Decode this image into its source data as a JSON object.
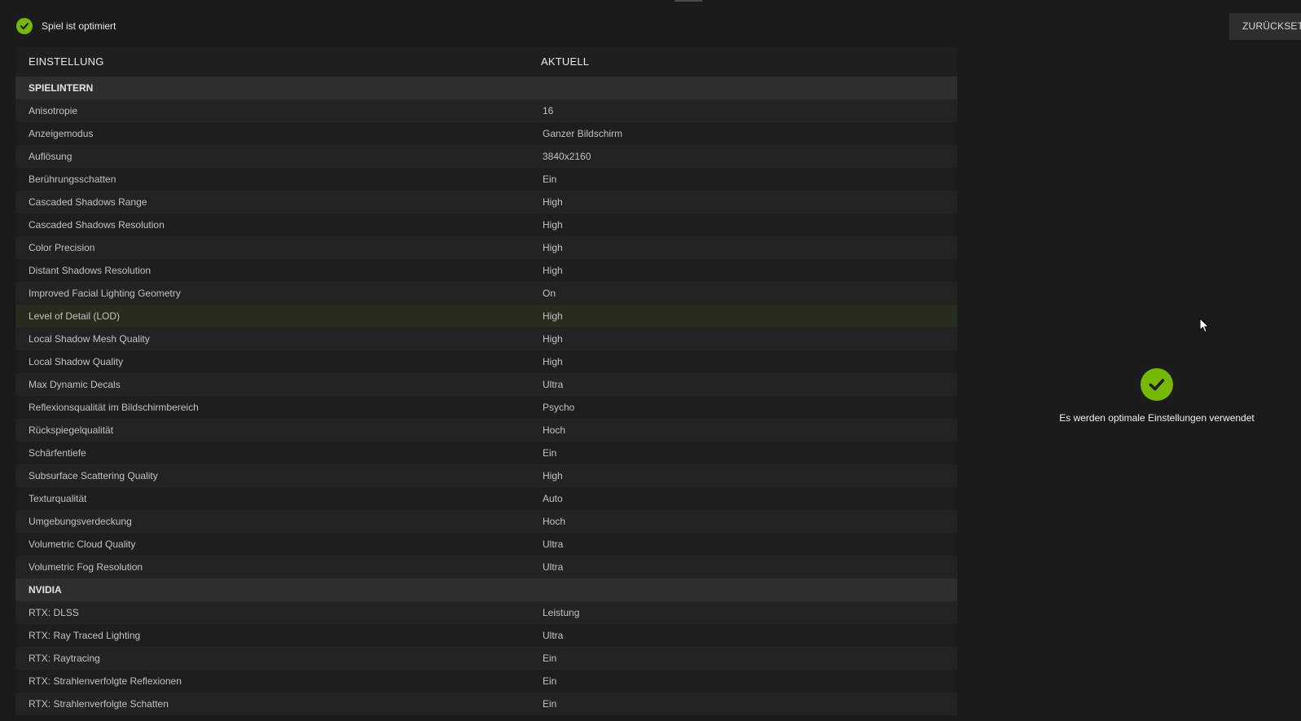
{
  "status": {
    "text": "Spiel ist optimiert",
    "icon": "check-circle-icon"
  },
  "reset_button": {
    "label": "ZURÜCKSETZ"
  },
  "table": {
    "headers": {
      "setting": "EINSTELLUNG",
      "current": "AKTUELL"
    },
    "sections": [
      {
        "title": "SPIELINTERN",
        "rows": [
          {
            "name": "Anisotropie",
            "value": "16"
          },
          {
            "name": "Anzeigemodus",
            "value": "Ganzer Bildschirm"
          },
          {
            "name": "Auflösung",
            "value": "3840x2160"
          },
          {
            "name": "Berührungsschatten",
            "value": "Ein"
          },
          {
            "name": "Cascaded Shadows Range",
            "value": "High"
          },
          {
            "name": "Cascaded Shadows Resolution",
            "value": "High"
          },
          {
            "name": "Color Precision",
            "value": "High"
          },
          {
            "name": "Distant Shadows Resolution",
            "value": "High"
          },
          {
            "name": "Improved Facial Lighting Geometry",
            "value": "On"
          },
          {
            "name": "Level of Detail (LOD)",
            "value": "High",
            "highlighted": true
          },
          {
            "name": "Local Shadow Mesh Quality",
            "value": "High"
          },
          {
            "name": "Local Shadow Quality",
            "value": "High"
          },
          {
            "name": "Max Dynamic Decals",
            "value": "Ultra"
          },
          {
            "name": "Reflexionsqualität im Bildschirmbereich",
            "value": "Psycho"
          },
          {
            "name": "Rückspiegelqualität",
            "value": "Hoch"
          },
          {
            "name": "Schärfentiefe",
            "value": "Ein"
          },
          {
            "name": "Subsurface Scattering Quality",
            "value": "High"
          },
          {
            "name": "Texturqualität",
            "value": "Auto"
          },
          {
            "name": "Umgebungsverdeckung",
            "value": "Hoch"
          },
          {
            "name": "Volumetric Cloud Quality",
            "value": "Ultra"
          },
          {
            "name": "Volumetric Fog Resolution",
            "value": "Ultra"
          }
        ]
      },
      {
        "title": "NVIDIA",
        "rows": [
          {
            "name": "RTX: DLSS",
            "value": "Leistung"
          },
          {
            "name": "RTX: Ray Traced Lighting",
            "value": "Ultra"
          },
          {
            "name": "RTX: Raytracing",
            "value": "Ein"
          },
          {
            "name": "RTX: Strahlenverfolgte Reflexionen",
            "value": "Ein"
          },
          {
            "name": "RTX: Strahlenverfolgte Schatten",
            "value": "Ein"
          }
        ]
      }
    ]
  },
  "optimal_panel": {
    "text": "Es werden optimale Einstellungen verwendet",
    "icon": "check-circle-icon"
  },
  "colors": {
    "accent": "#76b900",
    "background": "#1b1b1b",
    "highlight_row": "#262d1c"
  }
}
